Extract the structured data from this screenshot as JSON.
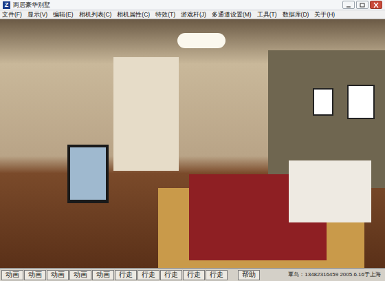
{
  "window": {
    "title": "两居豪华别墅",
    "logo": "Z"
  },
  "menu": [
    "文件(F)",
    "显示(V)",
    "编辑(E)",
    "相机列表(C)",
    "相机属性(C)",
    "特效(T)",
    "游戏杆(J)",
    "多通道设置(M)",
    "工具(T)",
    "数据库(D)",
    "关于(H)"
  ],
  "buttons": [
    "动画",
    "动画",
    "动画",
    "动画",
    "动画",
    "行走",
    "行走",
    "行走",
    "行走",
    "行走",
    "帮助"
  ],
  "status": "覃岛：13482316459  2005.6.16于上海"
}
